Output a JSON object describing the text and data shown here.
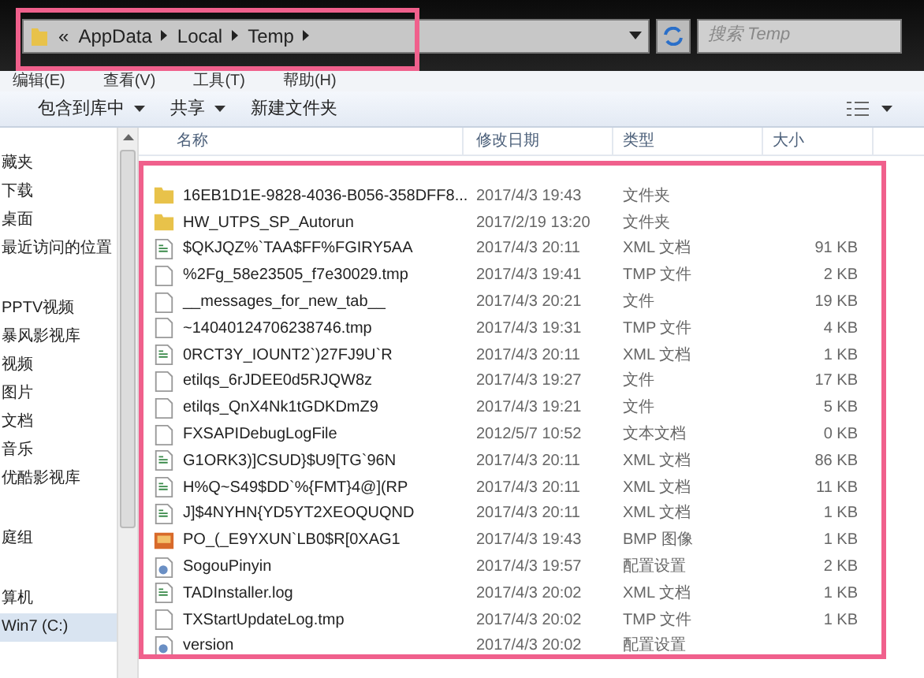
{
  "address_bar": {
    "overflow": "«",
    "crumbs": [
      "AppData",
      "Local",
      "Temp"
    ]
  },
  "search": {
    "placeholder": "搜索 Temp"
  },
  "menu": [
    "编辑(E)",
    "查看(V)",
    "工具(T)",
    "帮助(H)"
  ],
  "toolbar": [
    {
      "label": "包含到库中",
      "dropdown": true
    },
    {
      "label": "共享",
      "dropdown": true
    },
    {
      "label": "新建文件夹",
      "dropdown": false
    }
  ],
  "sidebar_groups": [
    {
      "items": [
        {
          "label": "藏夹",
          "selected": false
        },
        {
          "label": "下载",
          "selected": false
        },
        {
          "label": "桌面",
          "selected": false
        },
        {
          "label": "最近访问的位置",
          "selected": false
        }
      ]
    },
    {
      "items": [
        {
          "label": "PPTV视频",
          "selected": false
        },
        {
          "label": "暴风影视库",
          "selected": false
        },
        {
          "label": "视频",
          "selected": false
        },
        {
          "label": "图片",
          "selected": false
        },
        {
          "label": "文档",
          "selected": false
        },
        {
          "label": "音乐",
          "selected": false
        },
        {
          "label": "优酷影视库",
          "selected": false
        }
      ]
    },
    {
      "items": [
        {
          "label": "庭组",
          "selected": false
        }
      ]
    },
    {
      "items": [
        {
          "label": "算机",
          "selected": false
        },
        {
          "label": "Win7 (C:)",
          "selected": true
        }
      ]
    }
  ],
  "columns": [
    "名称",
    "修改日期",
    "类型",
    "大小"
  ],
  "rows": [
    {
      "kind": "folder",
      "name": "16EB1D1E-9828-4036-B056-358DFF8...",
      "date": "2017/4/3 19:43",
      "type": "文件夹"
    },
    {
      "kind": "folder",
      "name": "HW_UTPS_SP_Autorun",
      "date": "2017/2/19 13:20",
      "type": "文件夹"
    },
    {
      "kind": "xml",
      "name": "$QKJQZ%`TAA$FF%FGIRY5AA",
      "date": "2017/4/3 20:11",
      "type": "XML 文档",
      "size": "91 KB"
    },
    {
      "kind": "blank",
      "name": "%2Fg_58e23505_f7e30029.tmp",
      "date": "2017/4/3 19:41",
      "type": "TMP 文件",
      "size": "2 KB"
    },
    {
      "kind": "blank",
      "name": "__messages_for_new_tab__",
      "date": "2017/4/3 20:21",
      "type": "文件",
      "size": "19 KB"
    },
    {
      "kind": "blank",
      "name": "~14040124706238746.tmp",
      "date": "2017/4/3 19:31",
      "type": "TMP 文件",
      "size": "4 KB"
    },
    {
      "kind": "xml",
      "name": "0RCT3Y_IOUNT2`)27FJ9U`R",
      "date": "2017/4/3 20:11",
      "type": "XML 文档",
      "size": "1 KB"
    },
    {
      "kind": "blank",
      "name": "etilqs_6rJDEE0d5RJQW8z",
      "date": "2017/4/3 19:27",
      "type": "文件",
      "size": "17 KB"
    },
    {
      "kind": "blank",
      "name": "etilqs_QnX4Nk1tGDKDmZ9",
      "date": "2017/4/3 19:21",
      "type": "文件",
      "size": "5 KB"
    },
    {
      "kind": "blank",
      "name": "FXSAPIDebugLogFile",
      "date": "2012/5/7 10:52",
      "type": "文本文档",
      "size": "0 KB"
    },
    {
      "kind": "xml",
      "name": "G1ORK3)]CSUD}$U9[TG`96N",
      "date": "2017/4/3 20:11",
      "type": "XML 文档",
      "size": "86 KB"
    },
    {
      "kind": "xml",
      "name": "H%Q~S49$DD`%{FMT}4@](RP",
      "date": "2017/4/3 20:11",
      "type": "XML 文档",
      "size": "11 KB"
    },
    {
      "kind": "xml",
      "name": "J]$4NYHN{YD5YT2XEOQUQND",
      "date": "2017/4/3 20:11",
      "type": "XML 文档",
      "size": "1 KB"
    },
    {
      "kind": "bmp",
      "name": "PO_(_E9YXUN`LB0$R[0XAG1",
      "date": "2017/4/3 19:43",
      "type": "BMP 图像",
      "size": "1 KB"
    },
    {
      "kind": "config",
      "name": "SogouPinyin",
      "date": "2017/4/3 19:57",
      "type": "配置设置",
      "size": "2 KB"
    },
    {
      "kind": "xml",
      "name": "TADInstaller.log",
      "date": "2017/4/3 20:02",
      "type": "XML 文档",
      "size": "1 KB"
    },
    {
      "kind": "blank",
      "name": "TXStartUpdateLog.tmp",
      "date": "2017/4/3 20:02",
      "type": "TMP 文件",
      "size": "1 KB"
    },
    {
      "kind": "config",
      "name": "version",
      "date": "2017/4/3 20:02",
      "type": "配置设置"
    }
  ]
}
